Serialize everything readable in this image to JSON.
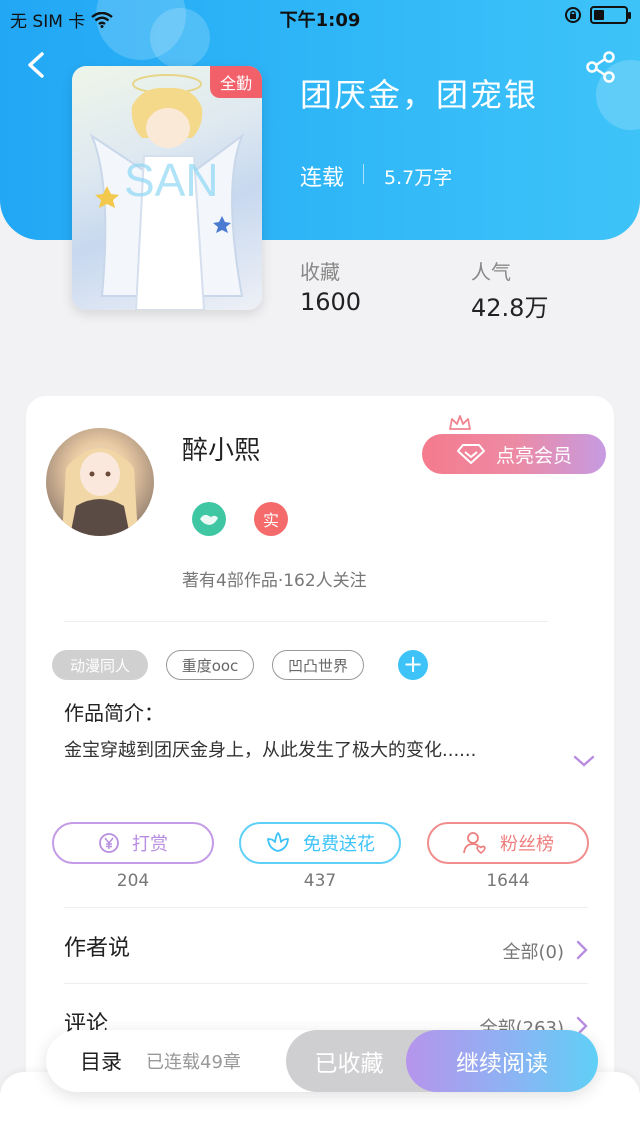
{
  "status_bar": {
    "carrier": "无 SIM 卡",
    "time": "下午1:09"
  },
  "book": {
    "badge": "全勤",
    "title": "团厌金，团宠银",
    "status": "连载",
    "word_count": "5.7万字",
    "stats": [
      {
        "label": "收藏",
        "value": "1600"
      },
      {
        "label": "人气",
        "value": "42.8万"
      }
    ]
  },
  "author": {
    "name": "醉小熙",
    "vip_button": "点亮会员",
    "verified_badge": "实",
    "meta": "著有4部作品·162人关注"
  },
  "tags": [
    "动漫同人",
    "重度ooc",
    "凹凸世界"
  ],
  "intro": {
    "title": "作品简介：",
    "text": "金宝穿越到团厌金身上，从此发生了极大的变化......"
  },
  "actions": [
    {
      "label": "打赏",
      "count": "204",
      "color": "#b98ee0"
    },
    {
      "label": "免费送花",
      "count": "437",
      "color": "#3ec3f8"
    },
    {
      "label": "粉丝榜",
      "count": "1644",
      "color": "#ef7e7e"
    }
  ],
  "rows": [
    {
      "label": "作者说",
      "right": "全部(0)"
    },
    {
      "label": "评论",
      "right": "全部(263)"
    }
  ],
  "bottom_bar": {
    "toc": "目录",
    "chapters": "已连载49章",
    "collected": "已收藏",
    "continue": "继续阅读"
  },
  "colors": {
    "header": "#2fb6f7",
    "accent_blue": "#3ec3f8",
    "vip_pink": "#f47b8c",
    "purple": "#b98ee0"
  }
}
